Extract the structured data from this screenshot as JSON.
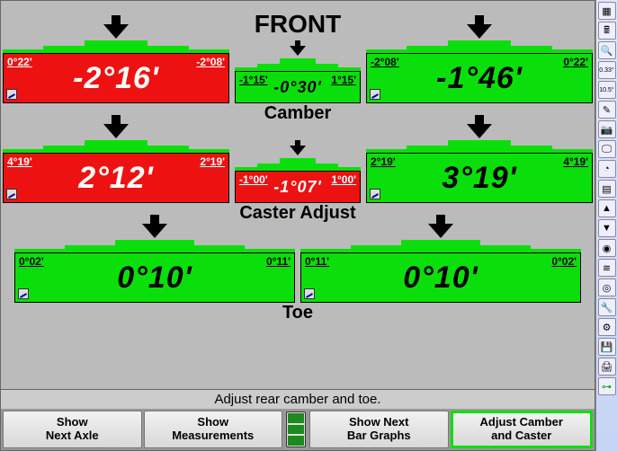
{
  "title": "FRONT",
  "sections": {
    "camber": {
      "label": "Camber",
      "left": {
        "low": "0°22'",
        "high": "-2°08'",
        "value": "-2°16'",
        "status": "red"
      },
      "cross": {
        "low": "-1°15'",
        "high": "1°15'",
        "value": "-0°30'",
        "status": "green"
      },
      "right": {
        "low": "-2°08'",
        "high": "0°22'",
        "value": "-1°46'",
        "status": "green"
      }
    },
    "caster": {
      "label": "Caster Adjust",
      "left": {
        "low": "4°19'",
        "high": "2°19'",
        "value": "2°12'",
        "status": "red"
      },
      "cross": {
        "low": "-1°00'",
        "high": "1°00'",
        "value": "-1°07'",
        "status": "red"
      },
      "right": {
        "low": "2°19'",
        "high": "4°19'",
        "value": "3°19'",
        "status": "green"
      }
    },
    "toe": {
      "label": "Toe",
      "left": {
        "low": "0°02'",
        "high": "0°11'",
        "value": "0°10'",
        "status": "green"
      },
      "right": {
        "low": "0°11'",
        "high": "0°02'",
        "value": "0°10'",
        "status": "green"
      }
    }
  },
  "status_text": "Adjust rear camber and toe.",
  "buttons": {
    "next_axle": "Show\nNext Axle",
    "measurements": "Show\nMeasurements",
    "bar_graphs": "Show Next\nBar Graphs",
    "adjust": "Adjust Camber\nand Caster"
  },
  "active_button": "adjust",
  "sidebar_icons": [
    "grid-icon",
    "calc-icon",
    "zoom-icon",
    "angle-033",
    "angle-105",
    "wand-icon",
    "camera-icon",
    "monitor-icon",
    "gauge-icon",
    "barchart-icon",
    "up-icon",
    "down-icon",
    "wheel-icon",
    "shocks-icon",
    "target-icon",
    "wrench-icon",
    "gear-icon",
    "disk-icon",
    "print-icon",
    "axle-icon"
  ]
}
